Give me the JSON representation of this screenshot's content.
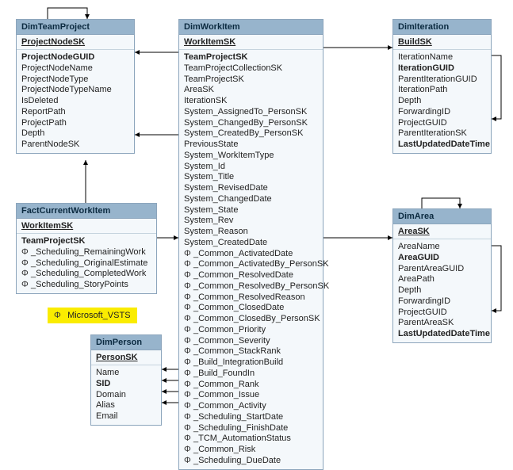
{
  "tables": {
    "dimTeamProject": {
      "title": "DimTeamProject",
      "pk": "ProjectNodeSK",
      "fields": [
        {
          "label": "ProjectNodeGUID",
          "bold": true
        },
        {
          "label": "ProjectNodeName"
        },
        {
          "label": "ProjectNodeType"
        },
        {
          "label": "ProjectNodeTypeName"
        },
        {
          "label": "IsDeleted"
        },
        {
          "label": "ReportPath"
        },
        {
          "label": "ProjectPath"
        },
        {
          "label": "Depth"
        },
        {
          "label": "ParentNodeSK"
        }
      ]
    },
    "factCurrentWorkItem": {
      "title": "FactCurrentWorkItem",
      "pk": "WorkItemSK",
      "fields": [
        {
          "label": "TeamProjectSK",
          "bold": true
        },
        {
          "label": "_Scheduling_RemainingWork",
          "phi": true
        },
        {
          "label": "_Scheduling_OriginalEstimate",
          "phi": true
        },
        {
          "label": "_Scheduling_CompletedWork",
          "phi": true
        },
        {
          "label": "_Scheduling_StoryPoints",
          "phi": true
        }
      ]
    },
    "dimWorkItem": {
      "title": "DimWorkItem",
      "pk": "WorkItemSK",
      "fields": [
        {
          "label": "TeamProjectSK",
          "bold": true
        },
        {
          "label": "TeamProjectCollectionSK"
        },
        {
          "label": "TeamProjectSK"
        },
        {
          "label": "AreaSK"
        },
        {
          "label": "IterationSK"
        },
        {
          "label": "System_AssignedTo_PersonSK"
        },
        {
          "label": "System_ChangedBy_PersonSK"
        },
        {
          "label": "System_CreatedBy_PersonSK"
        },
        {
          "label": "PreviousState"
        },
        {
          "label": "System_WorkItemType"
        },
        {
          "label": "System_Id"
        },
        {
          "label": "System_Title"
        },
        {
          "label": "System_RevisedDate"
        },
        {
          "label": "System_ChangedDate"
        },
        {
          "label": "System_State"
        },
        {
          "label": "System_Rev"
        },
        {
          "label": "System_Reason"
        },
        {
          "label": "System_CreatedDate"
        },
        {
          "label": "_Common_ActivatedDate",
          "phi": true
        },
        {
          "label": "_Common_ActivatedBy_PersonSK",
          "phi": true
        },
        {
          "label": "_Common_ResolvedDate",
          "phi": true
        },
        {
          "label": "_Common_ResolvedBy_PersonSK",
          "phi": true
        },
        {
          "label": "_Common_ResolvedReason",
          "phi": true
        },
        {
          "label": "_Common_ClosedDate",
          "phi": true
        },
        {
          "label": "_Common_ClosedBy_PersonSK",
          "phi": true
        },
        {
          "label": "_Common_Priority",
          "phi": true
        },
        {
          "label": "_Common_Severity",
          "phi": true
        },
        {
          "label": "_Common_StackRank",
          "phi": true
        },
        {
          "label": "_Build_IntegrationBuild",
          "phi": true
        },
        {
          "label": "_Build_FoundIn",
          "phi": true
        },
        {
          "label": "_Common_Rank",
          "phi": true
        },
        {
          "label": "_Common_Issue",
          "phi": true
        },
        {
          "label": "_Common_Activity",
          "phi": true
        },
        {
          "label": "_Scheduling_StartDate",
          "phi": true
        },
        {
          "label": "_Scheduling_FinishDate",
          "phi": true
        },
        {
          "label": "_TCM_AutomationStatus",
          "phi": true
        },
        {
          "label": "_Common_Risk",
          "phi": true
        },
        {
          "label": "_Scheduling_DueDate",
          "phi": true
        }
      ]
    },
    "dimIteration": {
      "title": "DimIteration",
      "pk": "BuildSK",
      "fields": [
        {
          "label": "IterationName"
        },
        {
          "label": "IterationGUID",
          "bold": true
        },
        {
          "label": "ParentIterationGUID"
        },
        {
          "label": "IterationPath"
        },
        {
          "label": "Depth"
        },
        {
          "label": "ForwardingID"
        },
        {
          "label": "ProjectGUID"
        },
        {
          "label": "ParentIterationSK"
        },
        {
          "label": "LastUpdatedDateTime",
          "bold": true
        }
      ]
    },
    "dimArea": {
      "title": "DimArea",
      "pk": "AreaSK",
      "fields": [
        {
          "label": "AreaName"
        },
        {
          "label": "AreaGUID",
          "bold": true
        },
        {
          "label": "ParentAreaGUID"
        },
        {
          "label": "AreaPath"
        },
        {
          "label": "Depth"
        },
        {
          "label": "ForwardingID"
        },
        {
          "label": "ProjectGUID"
        },
        {
          "label": "ParentAreaSK"
        },
        {
          "label": "LastUpdatedDateTime",
          "bold": true
        }
      ]
    },
    "dimPerson": {
      "title": "DimPerson",
      "pk": "PersonSK",
      "fields": [
        {
          "label": "Name"
        },
        {
          "label": "SID",
          "bold": true
        },
        {
          "label": "Domain"
        },
        {
          "label": "Alias"
        },
        {
          "label": "Email"
        }
      ]
    }
  },
  "legend": {
    "prefix": "Φ",
    "label": "Microsoft_VSTS"
  }
}
